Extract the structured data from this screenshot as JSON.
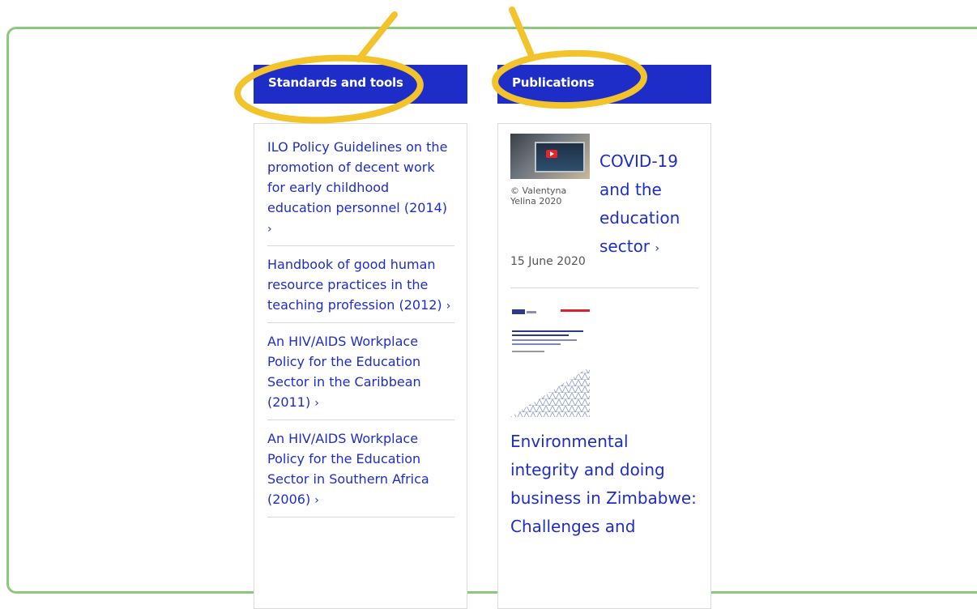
{
  "colors": {
    "accent": "#1e2dc8",
    "frame": "#8cc97c",
    "highlight": "#f2c32a"
  },
  "standards": {
    "header": "Standards and tools",
    "items": [
      {
        "label": "ILO Policy Guidelines on the promotion of decent work for early childhood education personnel (2014)"
      },
      {
        "label": "Handbook of good human resource practices in the teaching profession (2012)"
      },
      {
        "label": "An HIV/AIDS Workplace Policy for the Education Sector in the Caribbean (2011)"
      },
      {
        "label": "An HIV/AIDS Workplace Policy for the Education Sector in Southern Africa (2006)"
      }
    ],
    "chevron": "›"
  },
  "publications": {
    "header": "Publications",
    "items": [
      {
        "title": "COVID-19 and the education sector",
        "credit": "© Valentyna Yelina 2020",
        "date": "15 June 2020",
        "icon": "laptop-video-thumbnail"
      },
      {
        "title": "Environmental integrity and doing business in Zimbabwe: Challenges and",
        "icon": "report-cover-thumbnail"
      }
    ],
    "chevron": "›"
  }
}
